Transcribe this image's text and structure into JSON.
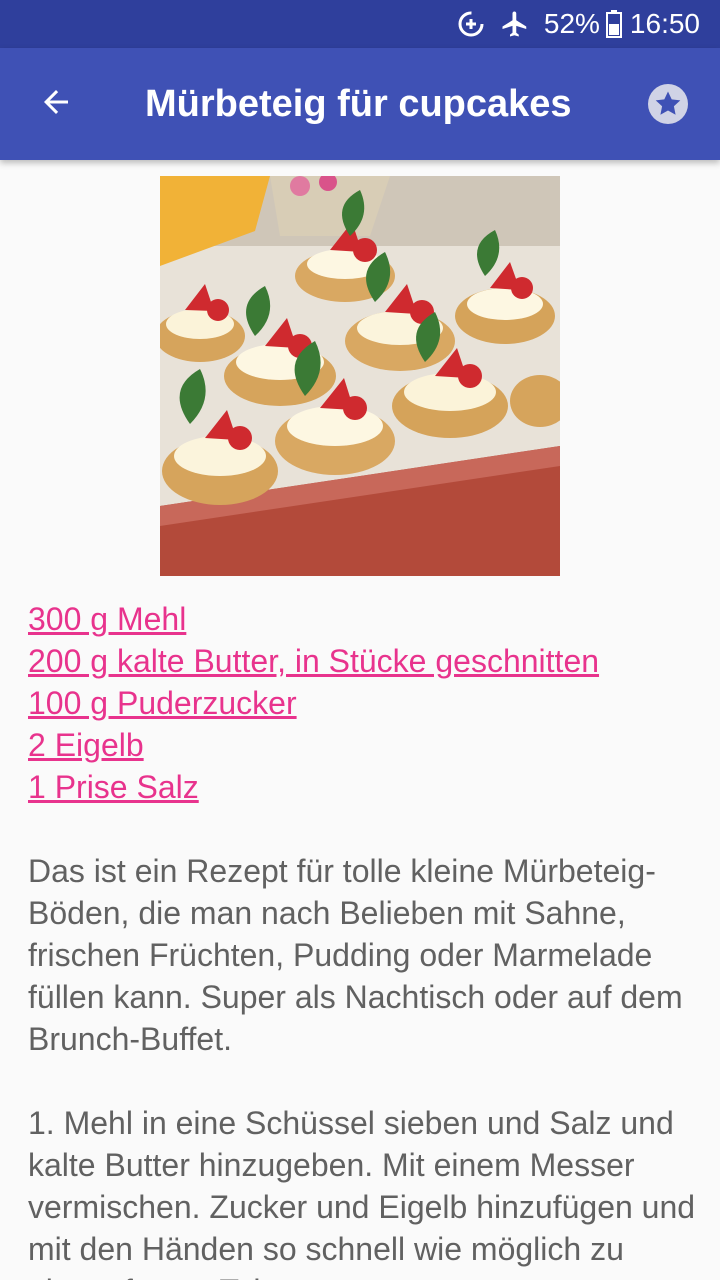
{
  "status_bar": {
    "battery_percent": "52%",
    "time": "16:50",
    "icons": [
      "data-saver-icon",
      "airplane-mode-icon",
      "battery-icon"
    ]
  },
  "app_bar": {
    "title": "Mürbeteig für cupcakes",
    "back_icon": "arrow-left-icon",
    "favorite_icon": "star-icon",
    "color": "#3f51b5",
    "status_color": "#2f3f9c"
  },
  "recipe": {
    "image": "strawberry-cream-tartlets-photo",
    "ingredients": [
      "300 g Mehl",
      "200 g kalte Butter, in Stücke geschnitten",
      "100 g Puderzucker",
      "2 Eigelb",
      "1 Prise Salz"
    ],
    "ingredient_link_color": "#e8338d",
    "description": "Das ist ein Rezept für tolle kleine Mürbeteig-Böden, die man nach Belieben mit Sahne, frischen Früchten, Pudding oder Marmelade füllen kann. Super als Nachtisch oder auf dem Brunch-Buffet.",
    "steps": [
      "1. Mehl in eine Schüssel sieben und Salz und kalte Butter hinzugeben. Mit einem Messer vermischen. Zucker und Eigelb hinzufügen und mit den Händen so schnell wie möglich zu einem festen Teig"
    ]
  }
}
